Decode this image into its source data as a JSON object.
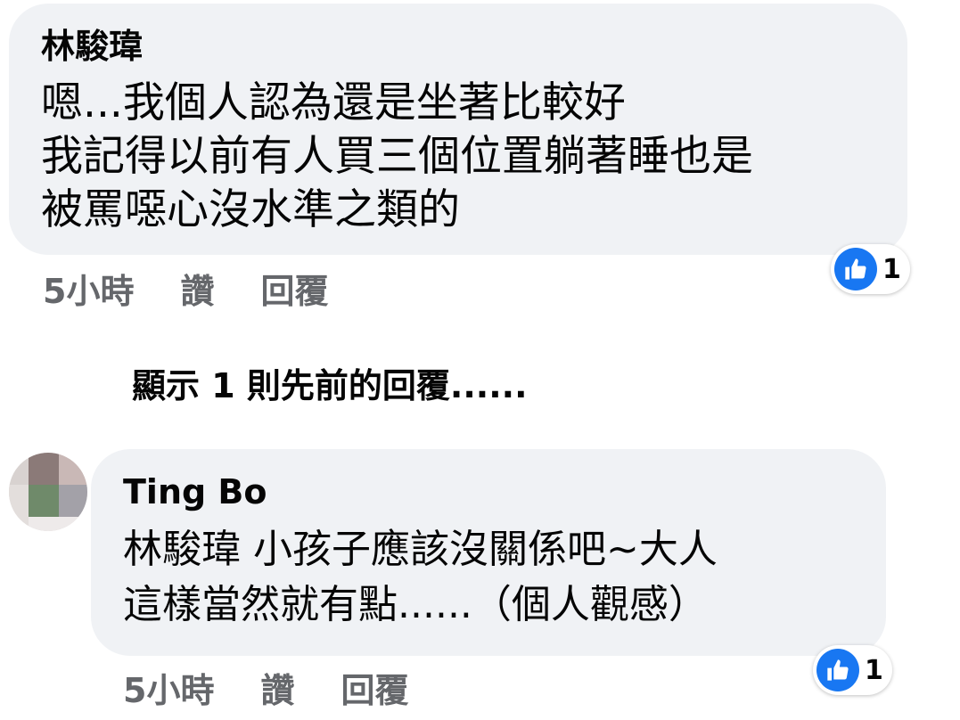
{
  "comments": [
    {
      "author": "林駿瑋",
      "lines": [
        "嗯...我個人認為還是坐著比較好",
        "我記得以前有人買三個位置躺著睡也是",
        "被罵噁心沒水準之類的"
      ],
      "time": "5小時",
      "like_label": "讚",
      "reply_label": "回覆",
      "reaction_icon": "like-thumbs-up-icon",
      "reaction_count": "1"
    },
    {
      "author": "Ting Bo",
      "lines": [
        "林駿瑋 小孩子應該沒關係吧~大人",
        "這樣當然就有點......（個人觀感）"
      ],
      "time": "5小時",
      "like_label": "讚",
      "reply_label": "回覆",
      "reaction_icon": "like-thumbs-up-icon",
      "reaction_count": "1"
    }
  ],
  "prev_replies_label": "顯示 1 則先前的回覆......",
  "colors": {
    "bubble_bg": "#f0f2f5",
    "text": "#050505",
    "meta_text": "#65676b",
    "like_blue": "#1877f2"
  }
}
